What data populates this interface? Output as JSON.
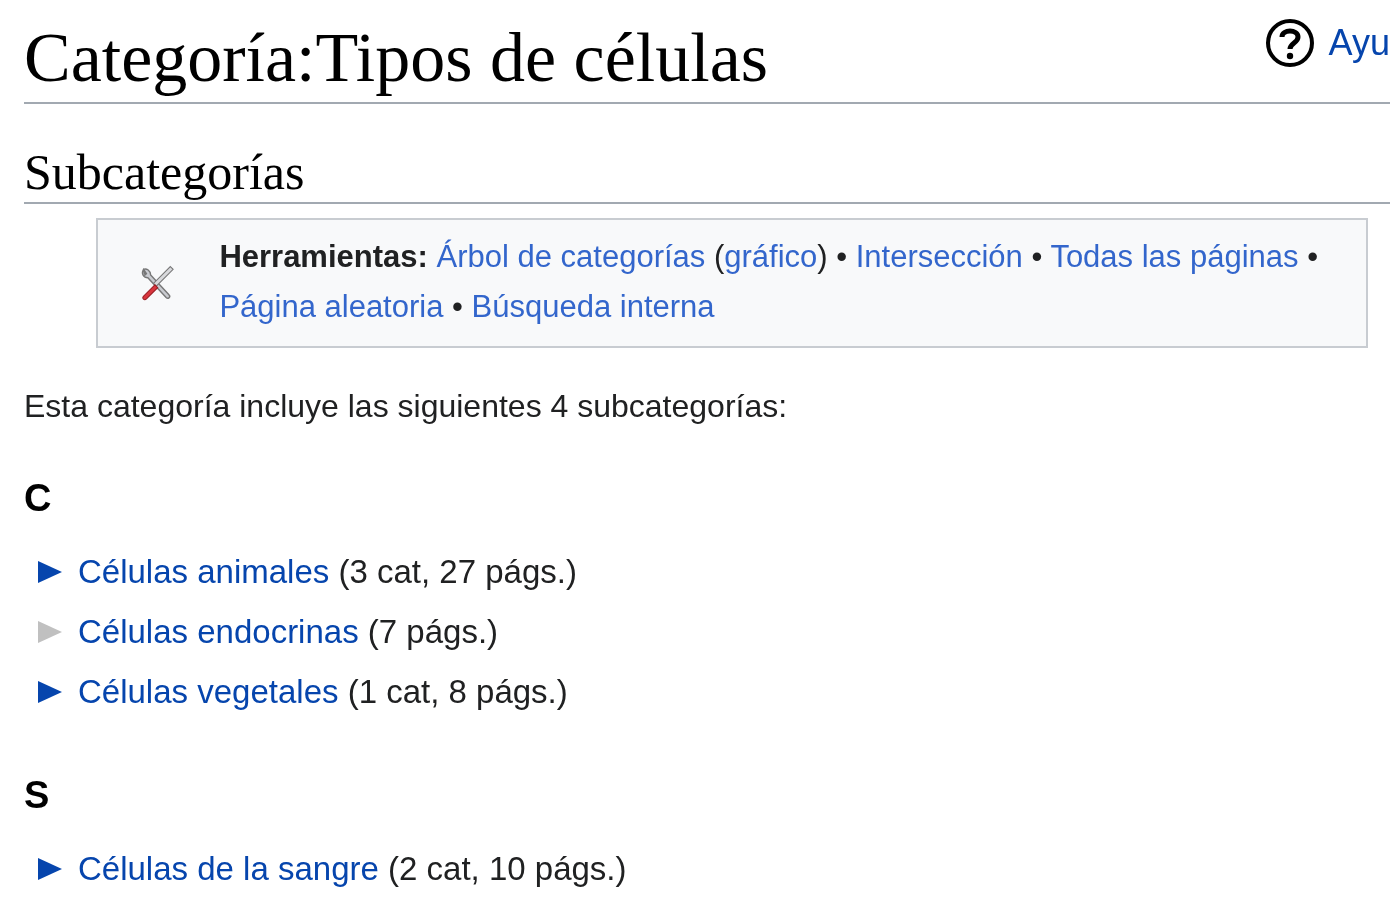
{
  "title": "Categoría:Tipos de células",
  "help_link": {
    "label": "Ayu"
  },
  "section": {
    "heading": "Subcategorías"
  },
  "toolbox": {
    "label": "Herramientas:",
    "parts": [
      {
        "kind": "link",
        "text": "Árbol de categorías"
      },
      {
        "kind": "text",
        "text": " ("
      },
      {
        "kind": "link",
        "text": "gráfico"
      },
      {
        "kind": "text",
        "text": ") • "
      },
      {
        "kind": "link",
        "text": "Intersección"
      },
      {
        "kind": "text",
        "text": " • "
      },
      {
        "kind": "link",
        "text": "Todas las páginas"
      },
      {
        "kind": "text",
        "text": " • "
      },
      {
        "kind": "link",
        "text": "Página aleatoria"
      },
      {
        "kind": "text",
        "text": " • "
      },
      {
        "kind": "link",
        "text": "Búsqueda interna"
      }
    ]
  },
  "intro": "Esta categoría incluye las siguientes 4 subcategorías:",
  "groups": [
    {
      "letter": "C",
      "items": [
        {
          "name": "Células animales",
          "count": "(3 cat, 27 págs.)",
          "has_children": true
        },
        {
          "name": "Células endocrinas",
          "count": "(7 págs.)",
          "has_children": false
        },
        {
          "name": "Células vegetales",
          "count": "(1 cat, 8 págs.)",
          "has_children": true
        }
      ]
    },
    {
      "letter": "S",
      "items": [
        {
          "name": "Células de la sangre",
          "count": "(2 cat, 10 págs.)",
          "has_children": true
        }
      ]
    }
  ]
}
